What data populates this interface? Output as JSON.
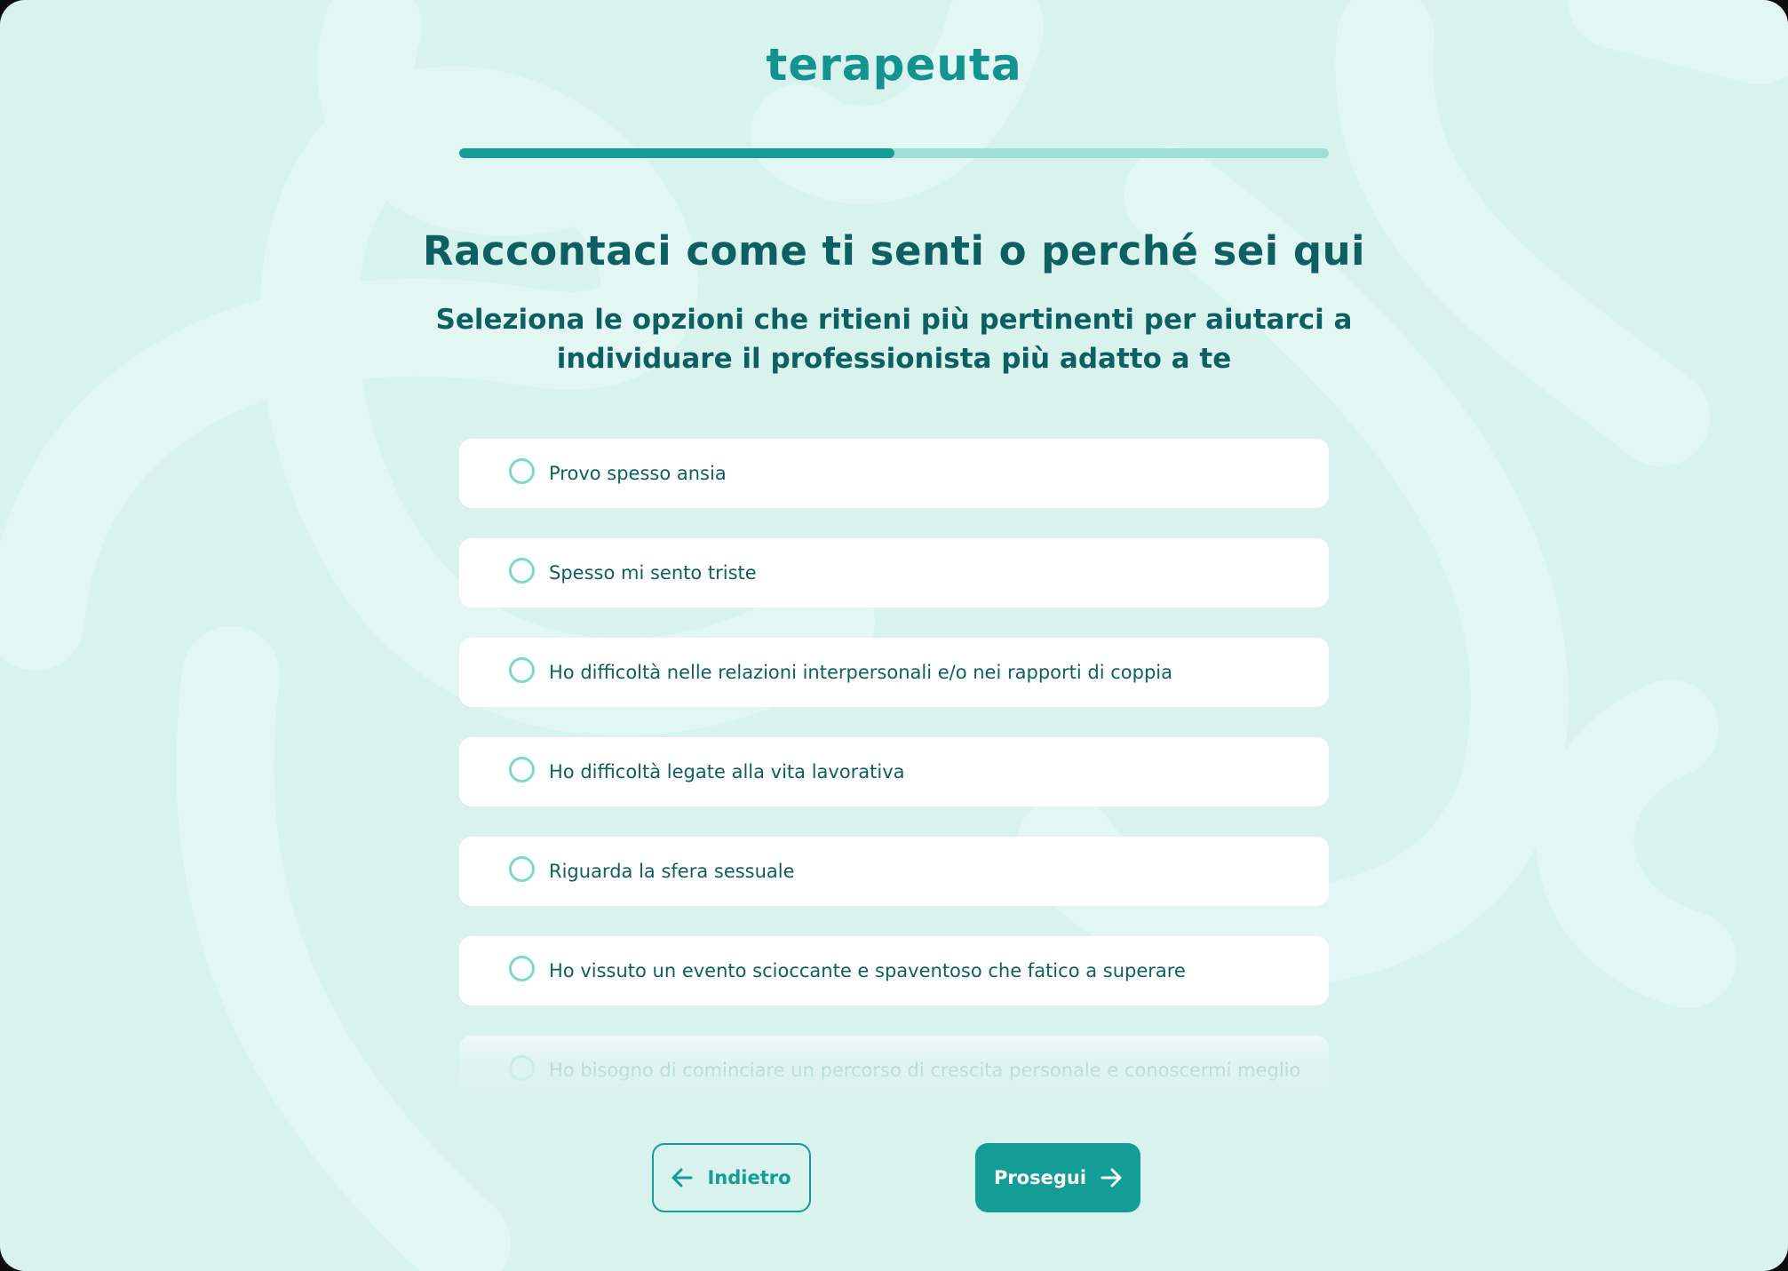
{
  "brand": {
    "logo_text": "terapeuta",
    "accent_color": "#149c97",
    "text_color": "#0e5f61",
    "background_color": "#d8f2ed"
  },
  "progress": {
    "fraction": 0.5
  },
  "header": {
    "title": "Raccontaci come ti senti o perché sei qui",
    "subtitle": "Seleziona le opzioni che ritieni più pertinenti per aiutarci a individuare il professionista più adatto a te"
  },
  "options": [
    {
      "label": "Provo spesso ansia",
      "selected": false
    },
    {
      "label": "Spesso mi sento triste",
      "selected": false
    },
    {
      "label": "Ho difficoltà nelle relazioni interpersonali e/o nei rapporti di coppia",
      "selected": false
    },
    {
      "label": "Ho difficoltà legate alla vita lavorativa",
      "selected": false
    },
    {
      "label": "Riguarda la sfera sessuale",
      "selected": false
    },
    {
      "label": "Ho vissuto un evento scioccante e spaventoso che fatico a superare",
      "selected": false
    },
    {
      "label": "Ho bisogno di cominciare un percorso di crescita personale e conoscermi meglio",
      "selected": false
    }
  ],
  "nav": {
    "back_label": "Indietro",
    "back_icon": "arrow-left-icon",
    "next_label": "Prosegui",
    "next_icon": "arrow-right-icon"
  }
}
